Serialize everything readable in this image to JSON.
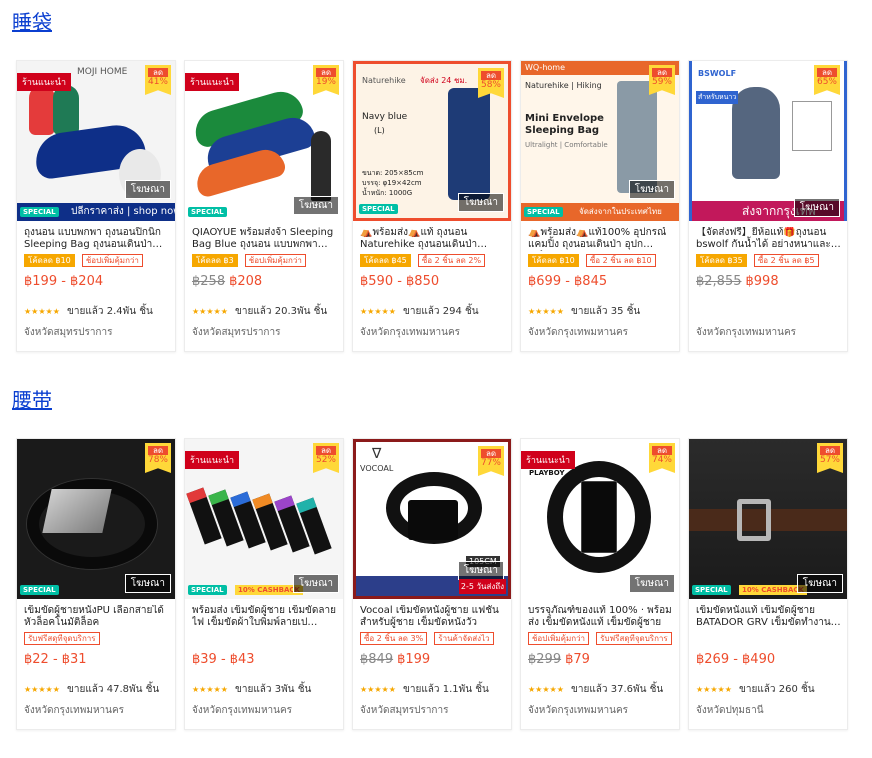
{
  "sections": [
    {
      "title": "睡袋",
      "products": [
        {
          "name": "ถุงนอน แบบพกพา ถุงนอนปิกนิก Sleeping Bag ถุงนอนเดินป่า ถุง…",
          "tags": [
            {
              "text": "โค้ดลด ฿10",
              "style": "fill"
            },
            {
              "text": "ช้อปเพิ่มคุ้มกว่า",
              "style": "outline"
            }
          ],
          "old_price": "",
          "price": "฿199 - ฿204",
          "sold": "ขายแล้ว 2.4พัน ชิ้น",
          "location": "จังหวัดสมุทรปราการ",
          "recommend": "ร้านแนะนำ",
          "discount": "41%",
          "discount_label": "ลด",
          "ad": "โฆษณา",
          "brand": "MOJI HOME",
          "banner": "ปลีกราคาส่ง | shop now",
          "special": "SPECIAL",
          "colors": [
            "#e43b3b",
            "#1f7a55",
            "#0e2f88"
          ]
        },
        {
          "name": "QIAOYUE พร้อมส่งจ้า Sleeping Bag Blue ถุงนอน แบบพกพา…",
          "tags": [
            {
              "text": "โค้ดลด ฿3",
              "style": "fill"
            },
            {
              "text": "ช้อปเพิ่มคุ้มกว่า",
              "style": "outline"
            }
          ],
          "old_price": "฿258",
          "price": "฿208",
          "sold": "ขายแล้ว 20.3พัน ชิ้น",
          "location": "จังหวัดสมุทรปราการ",
          "recommend": "ร้านแนะนำ",
          "discount": "19%",
          "discount_label": "ลด",
          "ad": "โฆษณา",
          "special": "SPECIAL",
          "colors": [
            "#1b8a3c",
            "#1c3f94",
            "#e8672a"
          ]
        },
        {
          "name": "⛺พร้อมส่ง⛺แท้ ถุงนอน Naturehike ถุงนอนเดินป่า พกพ…",
          "tags": [
            {
              "text": "โค้ดลด ฿45",
              "style": "fill"
            },
            {
              "text": "ซื้อ 2 ชิ้น ลด 2%",
              "style": "outline"
            }
          ],
          "old_price": "",
          "price": "฿590 - ฿850",
          "sold": "ขายแล้ว 294 ชิ้น",
          "location": "จังหวัดกรุงเทพมหานคร",
          "discount": "58%",
          "discount_label": "ลด",
          "ad": "โฆษณา",
          "brand": "Naturehike",
          "promo": "จัดส่ง 24 ชม.",
          "spec_title": "Navy blue",
          "spec_sub": "(L)",
          "spec_lines": [
            "ขนาด: 205×85cm",
            "บรรจุ: φ19×42cm",
            "น้ำหนัก: 1000G"
          ],
          "special": "SPECIAL",
          "colors": [
            "#1e3b76"
          ]
        },
        {
          "name": "⛺พร้อมส่ง⛺แท้100% อุปกรณ์ แคมปิ้ง ถุงนอนเดินป่า อุปกรณ์แ…",
          "tags": [
            {
              "text": "โค้ดลด ฿10",
              "style": "fill"
            },
            {
              "text": "ซื้อ 2 ชิ้น ลด ฿10",
              "style": "outline"
            }
          ],
          "old_price": "",
          "price": "฿699 - ฿845",
          "sold": "ขายแล้ว 35 ชิ้น",
          "location": "จังหวัดกรุงเทพมหานคร",
          "discount": "59%",
          "discount_label": "ลด",
          "ad": "โฆษณา",
          "brand": "WQ-home",
          "sub_brand": "Naturehike | Hiking",
          "headline": "Mini Envelope Sleeping Bag",
          "subline": "Ultralight | Comfortable",
          "banner": "จัดส่งจากในประเทศไทย",
          "special": "SPECIAL",
          "colors": [
            "#8a9aa6"
          ]
        },
        {
          "name": "【จัดส่งฟรี】ยี่ห้อแท้🎁ถุงนอน bswolf กันน้ำได้ อย่างหนาและ…",
          "tags": [
            {
              "text": "โค้ดลด ฿35",
              "style": "fill"
            },
            {
              "text": "ซื้อ 2 ชิ้น ลด ฿5",
              "style": "outline"
            }
          ],
          "old_price": "฿2,855",
          "price": "฿998",
          "sold": "",
          "location": "จังหวัดกรุงเทพมหานคร",
          "discount": "65%",
          "discount_label": "ลด",
          "ad": "โฆษณา",
          "brand": "BSWOLF",
          "banner": "ส่งจากกรุงเทพ",
          "tag_text": "สำหรับหนาว",
          "colors": [
            "#55667f"
          ]
        }
      ]
    },
    {
      "title": "腰带",
      "products": [
        {
          "name": "เข็มขัดผู้ชายหนังPU เลือกสายได้ หัวล็อคโนมัติล็อค",
          "tags": [
            {
              "text": "รับฟรีสดุทีจุดบริการ",
              "style": "outline"
            }
          ],
          "old_price": "",
          "price": "฿22 - ฿31",
          "sold": "ขายแล้ว 47.8พัน ชิ้น",
          "location": "จังหวัดกรุงเทพมหานคร",
          "discount": "78%",
          "discount_label": "ลด",
          "ad": "โฆษณา",
          "special": "SPECIAL",
          "colors": [
            "#111111"
          ]
        },
        {
          "name": "พร้อมส่ง เข็มขัดผู้ชาย เข็มขัดลาย ไฟ เข็มขัดผ้าใบพิมพ์ลายเป ผ่าน…",
          "tags": [],
          "old_price": "",
          "price": "฿39 - ฿43",
          "sold": "ขายแล้ว 3พัน ชิ้น",
          "location": "จังหวัดกรุงเทพมหานคร",
          "recommend": "ร้านแนะนำ",
          "discount": "52%",
          "discount_label": "ลด",
          "ad": "โฆษณา",
          "special": "SPECIAL",
          "cashback": "10% CASHBACK",
          "colors": [
            "#e23a3a",
            "#3ab54a",
            "#2b6cd8",
            "#f08a24",
            "#9b44c9",
            "#20b2aa"
          ]
        },
        {
          "name": "Vocoal เข็มขัดหนังผู้ชาย แฟชั่น สำหรับผู้ชาย เข็มขัดหนังวัว",
          "tags": [
            {
              "text": "ซื้อ 2 ชิ้น ลด 3%",
              "style": "outline"
            },
            {
              "text": "ร้านค้าจัดส่งไว",
              "style": "outline"
            }
          ],
          "old_price": "฿849",
          "price": "฿199",
          "sold": "ขายแล้ว 1.1พัน ชิ้น",
          "location": "จังหวัดสมุทรปราการ",
          "discount": "77%",
          "discount_label": "ลด",
          "ad": "โฆษณา",
          "brand": "VOCOAL",
          "size_label": "105CM",
          "ship_label": "2-5 วันส่งถึง",
          "colors": [
            "#111111"
          ]
        },
        {
          "name": "บรรจุภัณฑ์ของแท้ 100% · พร้อม ส่ง เข็มขัดหนังแท้ เข็มขัดผู้ชาย",
          "tags": [
            {
              "text": "ช้อปเพิ่มคุ้มกว่า",
              "style": "outline"
            },
            {
              "text": "รับฟรีสดุทีจุดบริการ",
              "style": "outline"
            }
          ],
          "old_price": "฿299",
          "price": "฿79",
          "sold": "ขายแล้ว 37.6พัน ชิ้น",
          "location": "จังหวัดกรุงเทพมหานคร",
          "recommend": "ร้านแนะนำ",
          "discount": "74%",
          "discount_label": "ลด",
          "ad": "โฆษณา",
          "brand": "PLAYBOY",
          "colors": [
            "#111111"
          ]
        },
        {
          "name": "เข็มขัดหนังแท้ เข็มขัดผู้ชาย BATADOR GRV เข็มขัดทำงาน…",
          "tags": [],
          "old_price": "",
          "price": "฿269 - ฿490",
          "sold": "ขายแล้ว 260 ชิ้น",
          "location": "จังหวัดปทุมธานี",
          "discount": "57%",
          "discount_label": "ลด",
          "ad": "โฆษณา",
          "special": "SPECIAL",
          "cashback": "10% CASHBACK",
          "colors": [
            "#4a2a1a"
          ]
        }
      ]
    }
  ],
  "rating_icon": "star-rating-icon"
}
